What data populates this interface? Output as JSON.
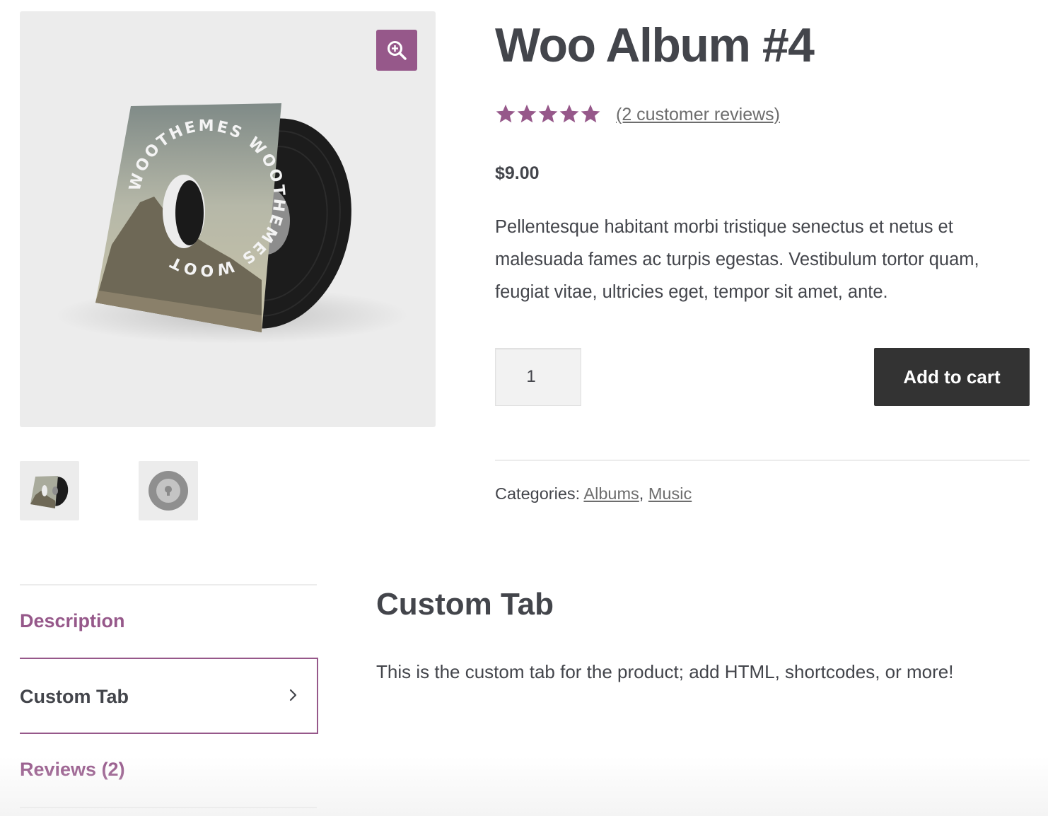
{
  "product": {
    "title": "Woo Album #4",
    "rating": 5,
    "rating_max": 5,
    "review_link": "(2 customer reviews)",
    "price": "$9.00",
    "description": "Pellentesque habitant morbi tristique senectus et netus et malesuada fames ac turpis egestas. Vestibulum tortor quam, feugiat vitae, ultricies eget, tempor sit amet, ante.",
    "quantity": "1",
    "add_to_cart": "Add to cart",
    "categories_label": "Categories:",
    "categories": [
      "Albums",
      "Music"
    ],
    "category_separator": ","
  },
  "gallery": {
    "sleeve_text": "WOOTHEMES WOOTHEMES WOOTHEMES",
    "zoom_icon": "zoom-in-icon"
  },
  "tabs": {
    "items": [
      {
        "label": "Description"
      },
      {
        "label": "Custom Tab"
      },
      {
        "label": "Reviews (2)"
      }
    ],
    "active_index": 1
  },
  "panel": {
    "title": "Custom Tab",
    "text": "This is the custom tab for the product; add HTML, shortcodes, or more!"
  },
  "colors": {
    "accent": "#96588a",
    "text": "#43454b",
    "button": "#333333",
    "link": "#6d6d6d",
    "image_bg": "#ececec"
  }
}
